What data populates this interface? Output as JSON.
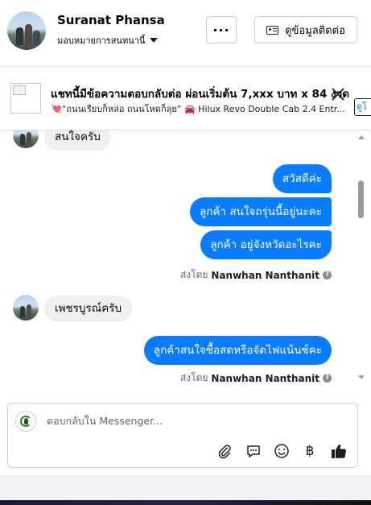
{
  "header": {
    "name": "Suranat Phansa",
    "assign_label": "มอบหมายการสนทนานี้",
    "more_label": "···",
    "contact_label": "ดูข้อมูลติดต่อ"
  },
  "ad": {
    "title": "แชทนี้มีข้อความตอบกลับต่อ ผ่อนเริ่มต้น 7,xxx บาท x 84 งวด",
    "subtitle": "💘“ถนนเรียบก็หล่อ ถนนโหดก็ลุย” 🚘 Hilux Revo Double Cab 2.4 Entr...",
    "link_label": "ดูโ"
  },
  "messages": [
    {
      "direction": "in",
      "text": "สนใจครับ"
    },
    {
      "direction": "out",
      "text": "สวัสดีค่ะ"
    },
    {
      "direction": "out",
      "text": "ลูกค้า สนใจถรุ่นนี้อยู่นะคะ"
    },
    {
      "direction": "out",
      "text": "ลูกค้า อยู่จังหวัดอะไรคะ"
    },
    {
      "direction": "in",
      "text": "เพชรบูรณ์ครับ"
    },
    {
      "direction": "out",
      "text": "ลูกค้าสนใจซื้อสดหรือจัดไฟแน้นซ์คะ"
    }
  ],
  "sent_by": {
    "prefix": "ส่งโดย",
    "agent": "Nanwhan Nanthanit",
    "info_glyph": "?"
  },
  "composer": {
    "placeholder": "ตอบกลับใน Messenger...",
    "tools": [
      "paperclip-icon",
      "chat-bubble-icon",
      "emoji-icon",
      "baht-icon",
      "thumbs-up-icon"
    ],
    "baht_glyph": "฿"
  },
  "colors": {
    "accent": "#0a7cff",
    "incoming_bubble": "#f0f0f0",
    "border": "#ccd0d5"
  }
}
